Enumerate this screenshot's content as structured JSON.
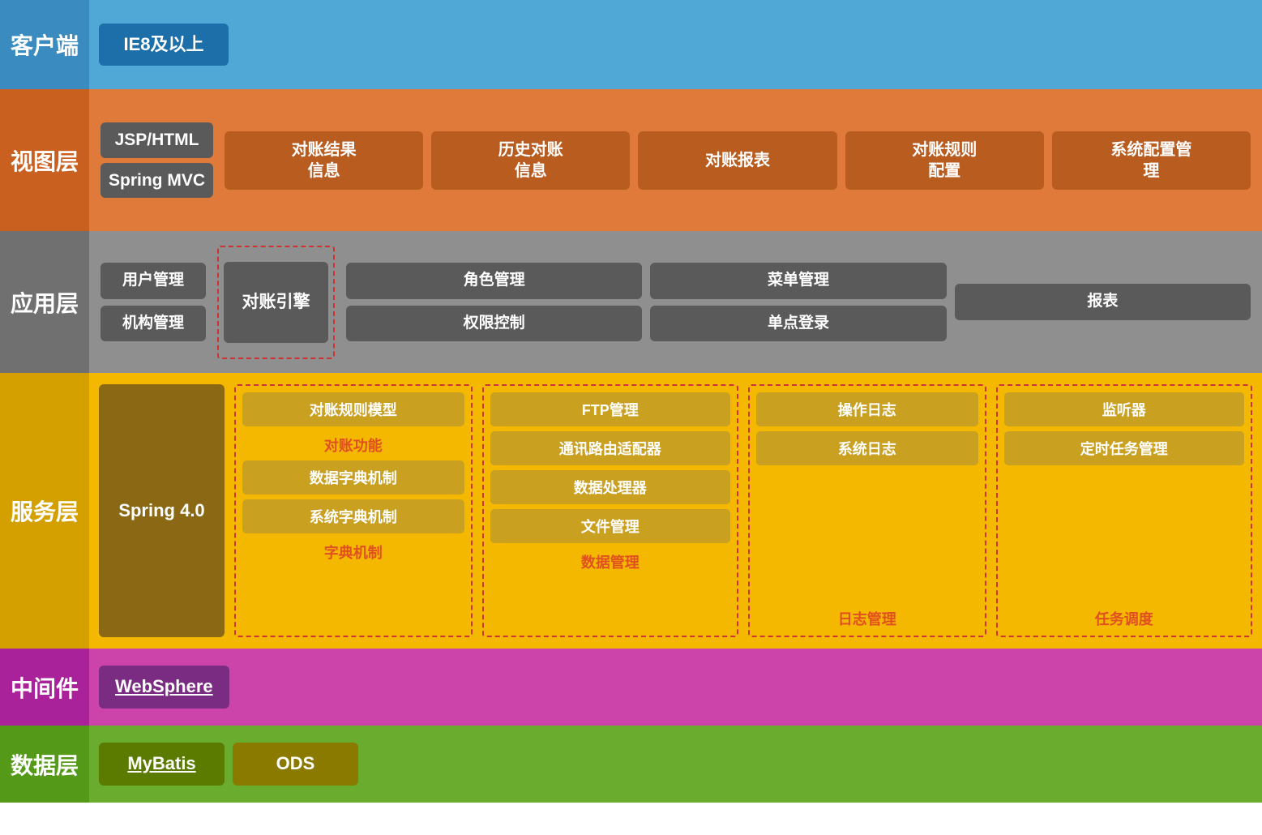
{
  "rows": {
    "client": {
      "label": "客户端",
      "color": "client",
      "box": "IE8及以上"
    },
    "view": {
      "label": "视图层",
      "box1_line1": "JSP/HTML",
      "box1_line2": "Spring MVC",
      "modules": [
        "对账结果信息",
        "历史对账信息",
        "对账报表",
        "对账规则配置",
        "系统配置管理"
      ]
    },
    "app": {
      "label": "应用层",
      "col1": [
        "用户管理",
        "机构管理"
      ],
      "dashed_box": "对账引擎",
      "col2": [
        "角色管理",
        "权限控制"
      ],
      "col3": [
        "菜单管理",
        "单点登录"
      ],
      "col4": [
        "报表",
        ""
      ]
    },
    "service": {
      "label": "服务层",
      "spring_box": "Spring 4.0",
      "group1": {
        "boxes": [
          "对账规则模型",
          "数据字典机制",
          "系统字典机制"
        ],
        "label": "对账功能\n字典机制",
        "label1": "对账功能",
        "label2": "字典机制"
      },
      "group2": {
        "boxes": [
          "FTP管理",
          "通讯路由适配器",
          "数据处理器",
          "文件管理"
        ],
        "label": "数据管理"
      },
      "group3": {
        "boxes": [
          "操作日志",
          "系统日志"
        ],
        "label": "日志管理"
      },
      "group4": {
        "boxes": [
          "监听器",
          "定时任务管理"
        ],
        "label": "任务调度"
      }
    },
    "middleware": {
      "label": "中间件",
      "box": "WebSphere"
    },
    "data": {
      "label": "数据层",
      "box1": "MyBatis",
      "box2": "ODS"
    }
  }
}
